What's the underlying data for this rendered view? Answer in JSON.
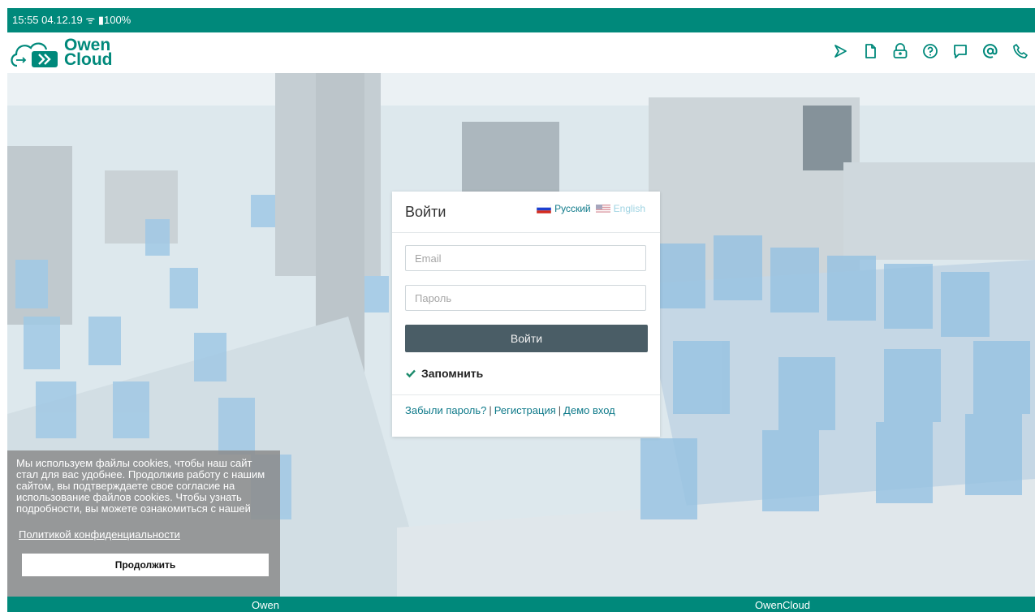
{
  "status_bar": {
    "text": "15:55 04.12.19 ᯤ ▮100%"
  },
  "logo": {
    "line1": "Owen",
    "line2": "Cloud"
  },
  "top_icons": [
    "play-icon",
    "document-icon",
    "lock-icon",
    "help-icon",
    "chat-icon",
    "at-icon",
    "phone-icon"
  ],
  "login": {
    "title": "Войти",
    "lang_ru": "Русский",
    "lang_en": "English",
    "email_placeholder": "Email",
    "password_placeholder": "Пароль",
    "submit_label": "Войти",
    "remember_label": "Запомнить",
    "forgot_link": "Забыли пароль?",
    "register_link": "Регистрация",
    "demo_link": "Демо вход",
    "separator": "|"
  },
  "cookie": {
    "text": "Мы используем файлы cookies, чтобы наш сайт стал для вас удобнее. Продолжив работу с нашим сайтом, вы подтверждаете свое согласие на использование файлов cookies. Чтобы узнать подробности, вы можете ознакомиться с нашей",
    "policy_link": "Политикой конфиденциальности",
    "continue_label": "Продолжить"
  },
  "footer": {
    "link1": "Owen",
    "link2": "OwenCloud"
  },
  "colors": {
    "brand": "#00897b",
    "button": "#4a5d66",
    "link": "#0f7a8a"
  }
}
